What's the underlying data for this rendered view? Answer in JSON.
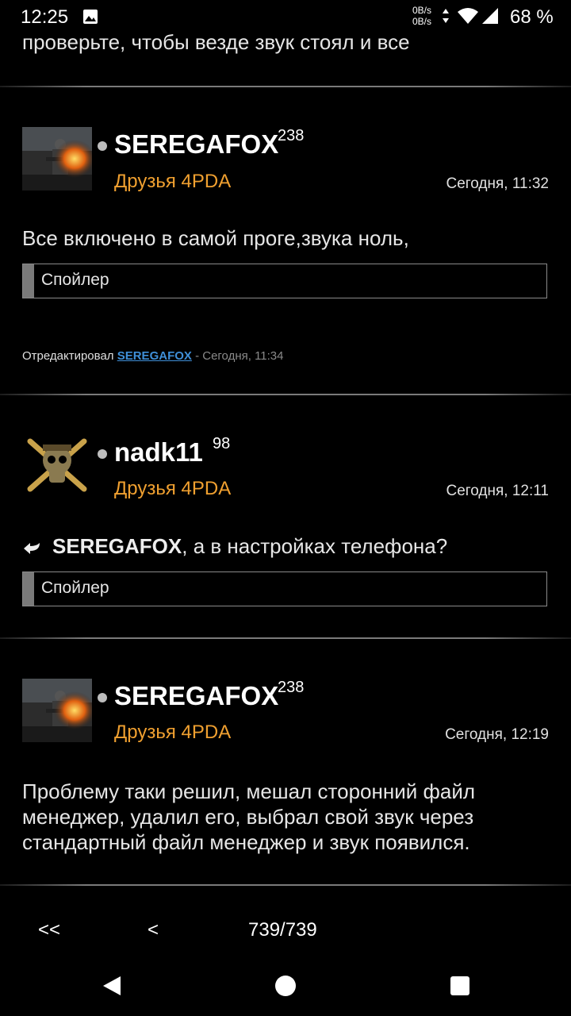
{
  "status": {
    "time": "12:25",
    "net_up": "0B/s",
    "net_down": "0B/s",
    "battery": "68 %"
  },
  "top_text": "проверьте, чтобы везде звук стоял и все",
  "posts": [
    {
      "username": "SEREGAFOX",
      "rep": "238",
      "group": "Друзья 4PDA",
      "date": "Сегодня, 11:32",
      "text": "Все включено в самой проге,звука ноль,",
      "spoiler": "Спойлер",
      "edited_prefix": "Отредактировал",
      "edited_by": "SEREGAFOX",
      "edited_suffix": "- Сегодня, 11:34",
      "avatar_icon": "avatar-soldier-fire-icon"
    },
    {
      "username": "nadk11",
      "rep": "98",
      "group": "Друзья 4PDA",
      "date": "Сегодня, 12:11",
      "reply_to": "SEREGAFOX",
      "text": ", а в настройках телефона?",
      "spoiler": "Спойлер",
      "avatar_icon": "avatar-skull-crossbones-icon"
    },
    {
      "username": "SEREGAFOX",
      "rep": "238",
      "group": "Друзья 4PDA",
      "date": "Сегодня, 12:19",
      "text": "Проблему таки решил, мешал сторонний файл менеджер, удалил его, выбрал свой звук через стандартный файл менеджер и звук появился.",
      "avatar_icon": "avatar-soldier-fire-icon"
    }
  ],
  "pager": {
    "first": "<<",
    "prev": "<",
    "page": "739/739"
  },
  "colors": {
    "group": "#f0a030",
    "link": "#3f8fd8",
    "background": "#000000"
  }
}
